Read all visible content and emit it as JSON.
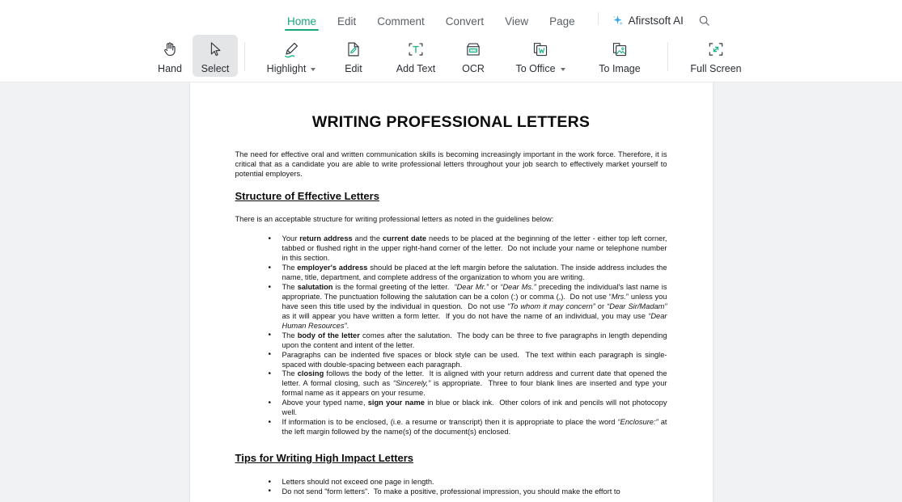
{
  "app": {
    "accent_color": "#18a47c",
    "ai_sparkle_color": "#2e9ce6"
  },
  "tabbar": {
    "tabs": [
      {
        "label": "Home",
        "active": true
      },
      {
        "label": "Edit",
        "active": false
      },
      {
        "label": "Comment",
        "active": false
      },
      {
        "label": "Convert",
        "active": false
      },
      {
        "label": "View",
        "active": false
      },
      {
        "label": "Page",
        "active": false
      }
    ],
    "ai_button_label": "Afirstsoft AI",
    "search_label": "Search"
  },
  "ribbon": {
    "tools": [
      {
        "id": "hand",
        "label": "Hand",
        "icon": "hand-icon",
        "active": false,
        "dropdown": false
      },
      {
        "id": "select",
        "label": "Select",
        "icon": "cursor-icon",
        "active": true,
        "dropdown": false
      },
      {
        "id": "highlight",
        "label": "Highlight",
        "icon": "highlighter-icon",
        "active": false,
        "dropdown": true
      },
      {
        "id": "edit",
        "label": "Edit",
        "icon": "edit-page-icon",
        "active": false,
        "dropdown": false
      },
      {
        "id": "add-text",
        "label": "Add Text",
        "icon": "add-text-icon",
        "active": false,
        "dropdown": false
      },
      {
        "id": "ocr",
        "label": "OCR",
        "icon": "ocr-icon",
        "active": false,
        "dropdown": false
      },
      {
        "id": "to-office",
        "label": "To Office",
        "icon": "to-office-icon",
        "active": false,
        "dropdown": true
      },
      {
        "id": "to-image",
        "label": "To Image",
        "icon": "to-image-icon",
        "active": false,
        "dropdown": false
      },
      {
        "id": "full-screen",
        "label": "Full Screen",
        "icon": "fullscreen-icon",
        "active": false,
        "dropdown": false
      }
    ]
  },
  "document": {
    "title": "WRITING PROFESSIONAL LETTERS",
    "intro": "The need for effective oral and written communication skills is becoming increasingly important in the work force. Therefore, it is critical that as a candidate you are able to write professional letters throughout your job search to effectively market yourself to potential employers.",
    "section1": {
      "heading": "Structure of Effective Letters",
      "lead": "There is an acceptable structure for writing professional letters as noted in the guidelines below:",
      "bullets": [
        "Your <b>return address</b> and the <b>current date</b> needs to be placed at the beginning of the letter - either top left corner, tabbed or flushed right in the upper right-hand corner of the letter.&nbsp; Do not include your name or telephone number in this section.",
        "The <b>employer's address</b> should be placed at the left margin before the salutation. The inside address includes the name, title, department, and complete address of the organization to whom you are writing.",
        "The <b>salutation</b> is the formal greeting of the letter.&nbsp; <i>“Dear Mr.”</i> or <i>“Dear Ms.”</i> preceding the individual's last name is appropriate. The punctuation following the salutation can be a colon (:) or comma (,).&nbsp; Do not use “<i>Mrs.</i>” unless you have seen this title used by the individual in question.&nbsp; Do not use <i>“To whom it may concern”</i> or <i>“Dear Sir/Madam”</i> as it will appear you have written a form letter.&nbsp; If you do not have the name of an individual, you may use <i>“Dear Human Resources”</i>.",
        "The <b>body of the letter</b> comes after the salutation.&nbsp; The body can be three to five paragraphs in length depending upon the content and intent of the letter.",
        "Paragraphs can be indented five spaces or block style can be used.&nbsp; The text within each paragraph is single-spaced with double-spacing between each paragraph.",
        "The <b>closing</b> follows the body of the letter.&nbsp; It is aligned with your return address and current date that opened the letter. A formal closing, such as <i>“Sincerely,”</i> is appropriate.&nbsp; Three to four blank lines are inserted and type your formal name as it appears on your resume.",
        "Above your typed name, <b>sign your name</b> in blue or black ink.&nbsp; Other colors of ink and pencils will not photocopy well.",
        "If information is to be enclosed, (i.e. a resume or transcript) then it is appropriate to place the word <i>“Enclosure:”</i> at the left margin followed by the name(s) of the document(s) enclosed."
      ]
    },
    "section2": {
      "heading": "Tips for Writing High Impact Letters",
      "bullets": [
        "Letters should not exceed one page in length.",
        "Do not send \"form letters\".&nbsp; To make a positive, professional impression, you should make the effort to"
      ]
    }
  }
}
